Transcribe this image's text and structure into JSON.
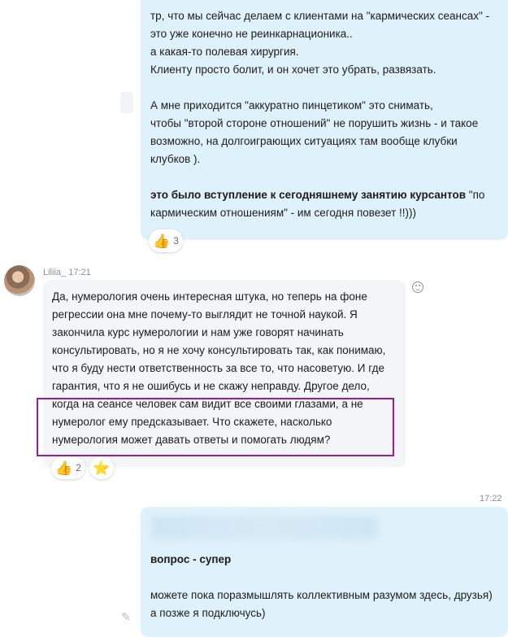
{
  "message_1": {
    "lines": [
      "тр, что мы сейчас делаем с клиентами на \"кармических сеансах\" -",
      "это уже конечно не реинкарнационика..",
      "а какая-то полевая хирургия.",
      "Клиенту просто болит, и он хочет это убрать, развязать.",
      "А мне приходится \"аккуратно пинцетиком\" это снимать,",
      "чтобы \"второй стороне отношений\" не порушить жизнь - и такое",
      "возможно, на долгоиграющих ситуациях там вообще клубки",
      "клубков )."
    ],
    "bold_part": "это было вступление к сегодняшнему занятию курсантов",
    "tail_part": " \"по",
    "last_line": "кармическим отношениям\" - им сегодня повезет !!)))",
    "reaction_count": "3"
  },
  "message_2": {
    "sender": "Liliia_",
    "time": "17:21",
    "lines": [
      "Да, нумерология очень интересная штука, но теперь на фоне",
      "регрессии она мне почему-то выглядит не точной наукой. Я",
      "закончила курс нумерологии и нам уже говорят начинать",
      "консультировать, но я не хочу консультировать так, как понимаю,",
      "что я буду нести ответственность за все то, что насоветую. И где",
      "гарантия, что я не ошибусь и не скажу неправду. Другое дело,",
      "когда на сеансе человек сам видит все своими глазами, а не",
      "нумеролог ему предсказывает. Что скажете, насколько",
      "нумерология может давать ответы и помогать людям?"
    ],
    "reaction_count": "2"
  },
  "message_3": {
    "time": "17:22",
    "bold_line": "вопрос - супер",
    "lines": [
      "можете пока поразмышлять коллективным разумом здесь, друзья)",
      "а позже я подключусь)"
    ]
  },
  "icons": {
    "thumbs": "👍",
    "star": "⭐",
    "pencil": "✎"
  }
}
